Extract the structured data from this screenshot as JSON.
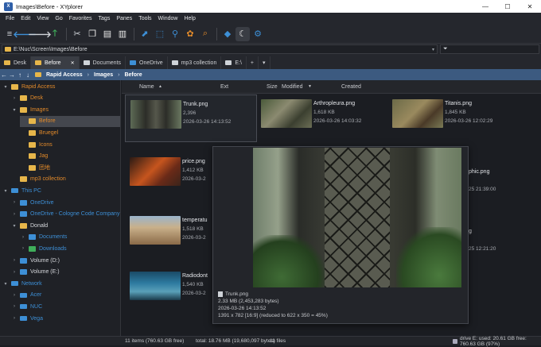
{
  "window": {
    "title": "Images\\Before - XYplorer",
    "app_icon": "X"
  },
  "menu": [
    "File",
    "Edit",
    "View",
    "Go",
    "Favorites",
    "Tags",
    "Panes",
    "Tools",
    "Window",
    "Help"
  ],
  "toolbar_icons": [
    "hamburger-icon",
    "back-icon",
    "forward-icon",
    "up-icon",
    "cut-icon",
    "copy-icon",
    "paste-icon",
    "paste-special-icon",
    "open-icon",
    "find-icon",
    "location-icon",
    "palette-icon",
    "search-icon",
    "gem-icon",
    "moon-icon",
    "settings-icon"
  ],
  "address": {
    "path": "E:\\Nuc\\Screen\\Images\\Before"
  },
  "tabs": [
    {
      "label": "Desk",
      "color": "#e7b64a"
    },
    {
      "label": "Before",
      "color": "#e7b64a",
      "active": true
    },
    {
      "label": "Documents",
      "color": "#cfd3d8"
    },
    {
      "label": "OneDrive",
      "color": "#3d8fd6"
    },
    {
      "label": "mp3 collection",
      "color": "#cfd3d8"
    },
    {
      "label": "E:\\",
      "color": "#cfd3d8"
    }
  ],
  "tab_add": "+",
  "breadcrumb": [
    "Rapid Access",
    "Images",
    "Before"
  ],
  "tree": [
    {
      "label": "Rapid Access",
      "depth": 0,
      "arrow": "▾",
      "icon": "yel",
      "color": "#e28a2a"
    },
    {
      "label": "Desk",
      "depth": 1,
      "arrow": "›",
      "icon": "yel",
      "color": "#e28a2a"
    },
    {
      "label": "Images",
      "depth": 1,
      "arrow": "▾",
      "icon": "yel",
      "color": "#e28a2a"
    },
    {
      "label": "Before",
      "depth": 2,
      "arrow": "",
      "icon": "yel",
      "color": "#e28a2a",
      "selected": true
    },
    {
      "label": "Bruegel",
      "depth": 2,
      "arrow": "",
      "icon": "yel",
      "color": "#e28a2a"
    },
    {
      "label": "Icons",
      "depth": 2,
      "arrow": "",
      "icon": "yel",
      "color": "#e28a2a"
    },
    {
      "label": "Jag",
      "depth": 2,
      "arrow": "",
      "icon": "yel",
      "color": "#e28a2a"
    },
    {
      "label": "团地",
      "depth": 2,
      "arrow": "",
      "icon": "yel",
      "color": "#e28a2a"
    },
    {
      "label": "mp3 collection",
      "depth": 1,
      "arrow": "",
      "icon": "yel",
      "color": "#e28a2a"
    },
    {
      "label": "This PC",
      "depth": 0,
      "arrow": "▾",
      "icon": "pc",
      "color": "#3d8fd6"
    },
    {
      "label": "OneDrive",
      "depth": 1,
      "arrow": "›",
      "icon": "blu",
      "color": "#3d8fd6"
    },
    {
      "label": "OneDrive - Cologne Code Company",
      "depth": 1,
      "arrow": "›",
      "icon": "blu",
      "color": "#3d8fd6"
    },
    {
      "label": "Donald",
      "depth": 1,
      "arrow": "▾",
      "icon": "yel",
      "color": "#d6d8dc"
    },
    {
      "label": "Documents",
      "depth": 2,
      "arrow": "›",
      "icon": "blu",
      "color": "#3d8fd6"
    },
    {
      "label": "Downloads",
      "depth": 2,
      "arrow": "›",
      "icon": "grn",
      "color": "#3d8fd6"
    },
    {
      "label": "Volume (D:)",
      "depth": 1,
      "arrow": "›",
      "icon": "blu",
      "color": "#d6d8dc"
    },
    {
      "label": "Volume (E:)",
      "depth": 1,
      "arrow": "›",
      "icon": "blu",
      "color": "#d6d8dc"
    },
    {
      "label": "Network",
      "depth": 0,
      "arrow": "▾",
      "icon": "pc",
      "color": "#3d8fd6"
    },
    {
      "label": "Acer",
      "depth": 1,
      "arrow": "›",
      "icon": "pc",
      "color": "#3d8fd6"
    },
    {
      "label": "NUC",
      "depth": 1,
      "arrow": "›",
      "icon": "pc",
      "color": "#3d8fd6"
    },
    {
      "label": "Vega",
      "depth": 1,
      "arrow": "›",
      "icon": "pc",
      "color": "#3d8fd6"
    }
  ],
  "columns": {
    "name": "Name",
    "ext": "Ext",
    "size": "Size",
    "modified": "Modified",
    "created": "Created"
  },
  "files": [
    {
      "name": "Trunk.png",
      "size": "2,396",
      "date": "2026-03-26 14:13:52",
      "thumb": "linear-gradient(90deg,#5d6a55,#2c2d28 30%,#55574b 50%,#2c2d28 70%,#6a7860)"
    },
    {
      "name": "Arthropleura.png",
      "size": "1,618 KB",
      "date": "2026-03-26 14:03:32",
      "thumb": "linear-gradient(135deg,#4a5a3a,#8b8a70 40%,#3b3f30 70%,#6b6e55)"
    },
    {
      "name": "Titanis.png",
      "size": "1,845 KB",
      "date": "2026-03-26 12:02:29",
      "thumb": "linear-gradient(135deg,#6b6a48,#9a8a5e 45%,#4a3a28 70%,#7a7a55)"
    },
    {
      "name": "price.png",
      "size": "1,412 KB",
      "date": "2026-03-2",
      "thumb": "linear-gradient(135deg,#2a1a14,#c6551e 45%,#6a2a18 70%,#3a241a)"
    },
    {
      "name": "temperatu",
      "size": "1,518 KB",
      "date": "2026-03-2",
      "thumb": "linear-gradient(180deg,#9ab4cc 0%,#c9b08a 40%,#8a6a48 100%)"
    },
    {
      "name": "Radiodont",
      "size": "1,540 KB",
      "date": "2026-03-2",
      "thumb": "linear-gradient(180deg,#1a4a66,#2d7aa0 40%,#5aa0b8 70%,#1a3a4a)"
    }
  ],
  "right_fragments": [
    {
      "text": "phic.png",
      "sub": "25 21:39:00"
    },
    {
      "text": "g",
      "sub": "25 12:21:20"
    }
  ],
  "preview": {
    "name": "Trunk.png",
    "size": "2.33 MB (2,453,283 bytes)",
    "date": "2026-03-26 14:13:52",
    "dims": "1391 x 782  [16:9]  (reduced to 622 x 350 = 45%)"
  },
  "status": {
    "items": "11 items (760.63 GB free)",
    "total": "total: 18.76 MB (19,680,097 bytes)",
    "files": "11 files",
    "drive": "drive E:  used: 20.61 GB  free: 760.63 GB (97%)"
  }
}
